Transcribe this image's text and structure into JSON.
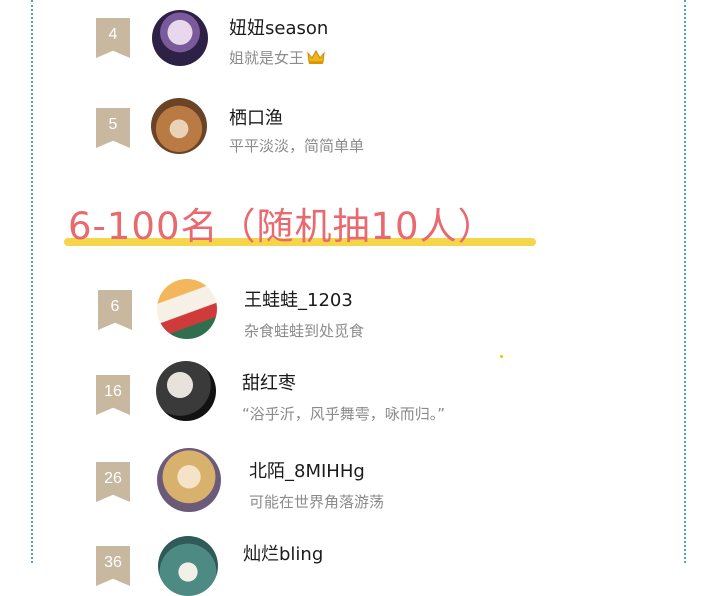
{
  "section_title": "6-100名（随机抽10人）",
  "crown_icon": "crown-icon",
  "entries": [
    {
      "rank": "4",
      "name": "妞妞season",
      "bio": "姐就是女王",
      "bio_icon": "crown-emoji"
    },
    {
      "rank": "5",
      "name": "栖口渔",
      "bio": "平平淡淡，简简单单"
    },
    {
      "rank": "6",
      "name": "王蛙蛙_1203",
      "bio": "杂食蛙蛙到处觅食"
    },
    {
      "rank": "16",
      "name": "甜红枣",
      "bio": "“浴乎沂，风乎舞雩，咏而归。”"
    },
    {
      "rank": "26",
      "name": "北陌_8MIHHg",
      "bio": "可能在世界角落游荡"
    },
    {
      "rank": "36",
      "name": "灿烂bling",
      "bio": ""
    }
  ],
  "colors": {
    "accent": "#e86a6f",
    "underline": "#f5d54a",
    "rank_badge": "#c8b89f",
    "border": "#4aa6c9"
  }
}
